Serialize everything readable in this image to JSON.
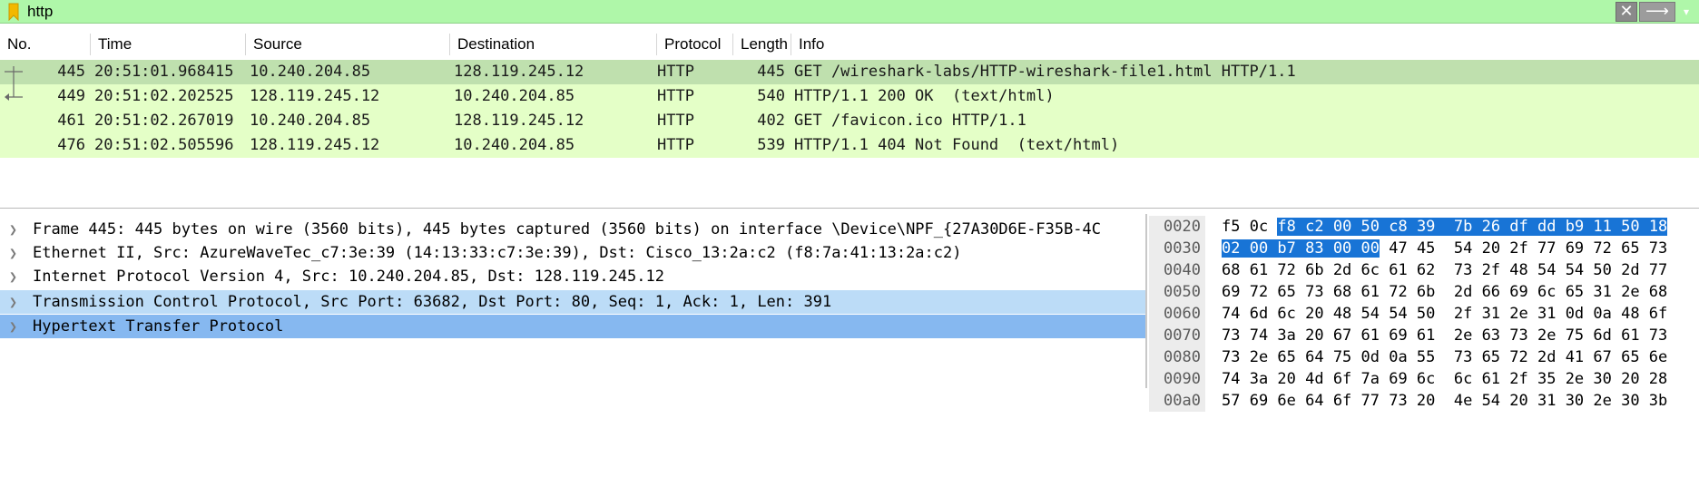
{
  "filter": {
    "value": "http",
    "clear_glyph": "✕",
    "apply_glyph": "⟶",
    "dropdown_glyph": "▾",
    "bookmark_color": "#f2b800",
    "bar_color": "#aff7a9"
  },
  "columns": [
    "No.",
    "Time",
    "Source",
    "Destination",
    "Protocol",
    "Length",
    "Info"
  ],
  "packets": [
    {
      "no": "445",
      "time": "20:51:01.968415",
      "source": "10.240.204.85",
      "destination": "128.119.245.12",
      "protocol": "HTTP",
      "length": "445",
      "info": "GET /wireshark-labs/HTTP-wireshark-file1.html HTTP/1.1",
      "selected": true
    },
    {
      "no": "449",
      "time": "20:51:02.202525",
      "source": "128.119.245.12",
      "destination": "10.240.204.85",
      "protocol": "HTTP",
      "length": "540",
      "info": "HTTP/1.1 200 OK  (text/html)",
      "selected": false
    },
    {
      "no": "461",
      "time": "20:51:02.267019",
      "source": "10.240.204.85",
      "destination": "128.119.245.12",
      "protocol": "HTTP",
      "length": "402",
      "info": "GET /favicon.ico HTTP/1.1",
      "selected": false
    },
    {
      "no": "476",
      "time": "20:51:02.505596",
      "source": "128.119.245.12",
      "destination": "10.240.204.85",
      "protocol": "HTTP",
      "length": "539",
      "info": "HTTP/1.1 404 Not Found  (text/html)",
      "selected": false
    }
  ],
  "details": [
    {
      "text": "Frame 445: 445 bytes on wire (3560 bits), 445 bytes captured (3560 bits) on interface \\Device\\NPF_{27A30D6E-F35B-4C",
      "highlight": "none"
    },
    {
      "text": "Ethernet II, Src: AzureWaveTec_c7:3e:39 (14:13:33:c7:3e:39), Dst: Cisco_13:2a:c2 (f8:7a:41:13:2a:c2)",
      "highlight": "none"
    },
    {
      "text": "Internet Protocol Version 4, Src: 10.240.204.85, Dst: 128.119.245.12",
      "highlight": "none"
    },
    {
      "text": "Transmission Control Protocol, Src Port: 63682, Dst Port: 80, Seq: 1, Ack: 1, Len: 391",
      "highlight": "light"
    },
    {
      "text": "Hypertext Transfer Protocol",
      "highlight": "strong"
    }
  ],
  "bytes": [
    {
      "offset": "0020",
      "pre": "f5 0c ",
      "sel": "f8 c2 00 50 c8 39  7b 26 df dd b9 11 50 18",
      "post": ""
    },
    {
      "offset": "0030",
      "pre": "",
      "sel": "02 00 b7 83 00 00",
      "post": " 47 45  54 20 2f 77 69 72 65 73"
    },
    {
      "offset": "0040",
      "pre": "68 61 72 6b 2d 6c 61 62  73 2f 48 54 54 50 2d 77",
      "sel": "",
      "post": ""
    },
    {
      "offset": "0050",
      "pre": "69 72 65 73 68 61 72 6b  2d 66 69 6c 65 31 2e 68",
      "sel": "",
      "post": ""
    },
    {
      "offset": "0060",
      "pre": "74 6d 6c 20 48 54 54 50  2f 31 2e 31 0d 0a 48 6f",
      "sel": "",
      "post": ""
    },
    {
      "offset": "0070",
      "pre": "73 74 3a 20 67 61 69 61  2e 63 73 2e 75 6d 61 73",
      "sel": "",
      "post": ""
    },
    {
      "offset": "0080",
      "pre": "73 2e 65 64 75 0d 0a 55  73 65 72 2d 41 67 65 6e",
      "sel": "",
      "post": ""
    },
    {
      "offset": "0090",
      "pre": "74 3a 20 4d 6f 7a 69 6c  6c 61 2f 35 2e 30 20 28",
      "sel": "",
      "post": ""
    },
    {
      "offset": "00a0",
      "pre": "57 69 6e 64 6f 77 73 20  4e 54 20 31 30 2e 30 3b",
      "sel": "",
      "post": ""
    }
  ],
  "colors": {
    "row_selected": "#bfe0ae",
    "row_normal": "#e4ffc7",
    "detail_light": "#bcdcf7",
    "detail_strong": "#86b8f0",
    "byte_selection": "#1874d6"
  }
}
